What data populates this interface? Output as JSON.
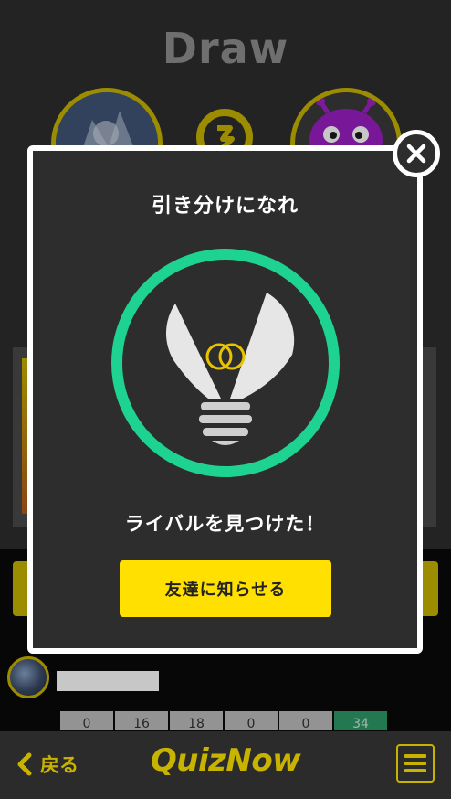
{
  "result": {
    "title": "Draw"
  },
  "player": {
    "avatar": "player-avatar"
  },
  "rival": {
    "avatar": "purple-monster-avatar"
  },
  "stats": {
    "values": [
      "0",
      "16",
      "18",
      "0",
      "0",
      "34"
    ]
  },
  "modal": {
    "title": "引き分けになれ",
    "icon": "lightbulb-icon",
    "message": "ライバルを見つけた！",
    "notify_button": "友達に知らせる",
    "close_icon": "close-icon"
  },
  "footer": {
    "back_label": "戻る",
    "brand": "QuizNow",
    "menu_icon": "hamburger-menu-icon"
  },
  "colors": {
    "accent": "#c8b400",
    "button": "#ffe000",
    "ring": "#1ed391",
    "modal_bg": "#2d2d2d",
    "highlight_cell": "#2e9a6a"
  }
}
